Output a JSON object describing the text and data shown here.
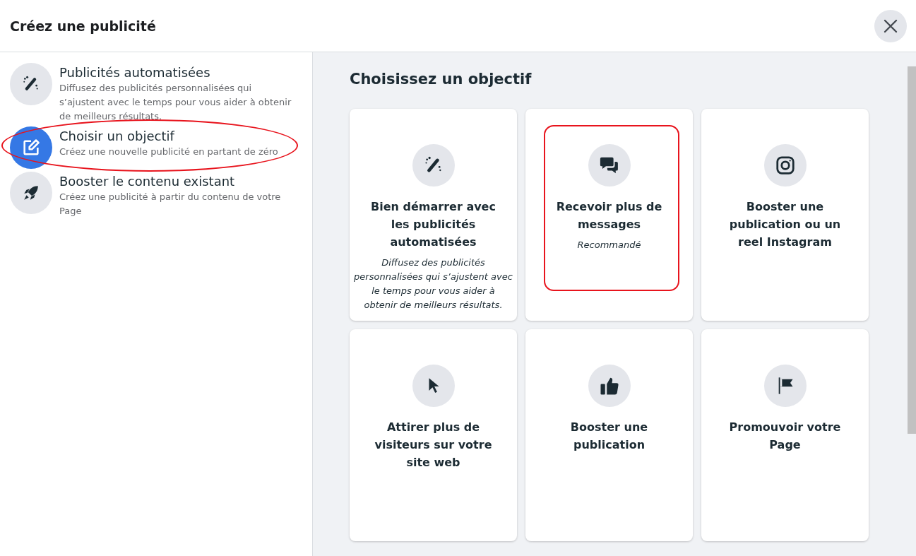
{
  "dialog": {
    "title": "Créez une publicité"
  },
  "sidebar": {
    "items": [
      {
        "kind": "automated",
        "title": "Publicités automatisées",
        "description": "Diffusez des publicités personnalisées qui s’ajustent avec le temps pour vous aider à obtenir de meilleurs résultats.",
        "selected": false,
        "annotated": false
      },
      {
        "kind": "objective",
        "title": "Choisir un objectif",
        "description": "Créez une nouvelle publicité en partant de zéro",
        "selected": true,
        "annotated": true
      },
      {
        "kind": "boost",
        "title": "Booster le contenu existant",
        "description": "Créez une publicité à partir du contenu de votre Page",
        "selected": false,
        "annotated": false
      }
    ]
  },
  "main": {
    "heading": "Choisissez un objectif",
    "cards": [
      {
        "kind": "automated",
        "title": "Bien démarrer avec les publicités automatisées",
        "description": "Diffusez des publicités personnalisées qui s’ajustent avec le temps pour vous aider à obtenir de meilleurs résultats.",
        "annotated": false
      },
      {
        "kind": "messages",
        "title": "Recevoir plus de messages",
        "description": "Recommandé",
        "annotated": true
      },
      {
        "kind": "instagram",
        "title": "Booster une publication ou un reel Instagram",
        "annotated": false
      },
      {
        "kind": "traffic",
        "title": "Attirer plus de visiteurs sur votre site web",
        "annotated": false
      },
      {
        "kind": "engagement",
        "title": "Booster une publication",
        "annotated": false
      },
      {
        "kind": "page",
        "title": "Promouvoir votre Page",
        "annotated": false
      }
    ]
  }
}
